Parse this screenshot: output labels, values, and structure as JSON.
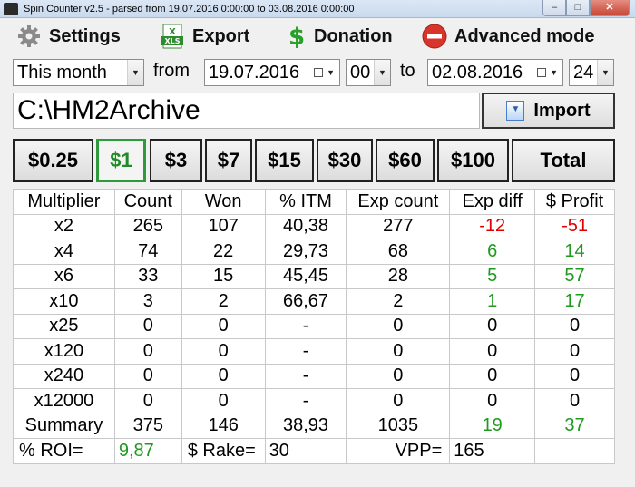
{
  "window": {
    "title": "Spin Counter v2.5 - parsed from 19.07.2016 0:00:00 to 03.08.2016 0:00:00",
    "icon_text": "SPIN"
  },
  "toolbar": {
    "settings": "Settings",
    "export": "Export",
    "donation": "Donation",
    "advanced": "Advanced mode"
  },
  "filters": {
    "period": "This month",
    "from_label": "from",
    "from_date": "19.07.2016",
    "from_hour": "00",
    "to_label": "to",
    "to_date": "02.08.2016",
    "to_hour": "24"
  },
  "path": {
    "value": "C:\\HM2Archive"
  },
  "import_label": "Import",
  "stakes": [
    "$0.25",
    "$1",
    "$3",
    "$7",
    "$15",
    "$30",
    "$60",
    "$100",
    "Total"
  ],
  "active_stake": "$1",
  "table": {
    "headers": [
      "Multiplier",
      "Count",
      "Won",
      "% ITM",
      "Exp count",
      "Exp diff",
      "$ Profit"
    ],
    "rows": [
      [
        "x2",
        "265",
        "107",
        "40,38",
        "277",
        "-12",
        "-51"
      ],
      [
        "x4",
        "74",
        "22",
        "29,73",
        "68",
        "6",
        "14"
      ],
      [
        "x6",
        "33",
        "15",
        "45,45",
        "28",
        "5",
        "57"
      ],
      [
        "x10",
        "3",
        "2",
        "66,67",
        "2",
        "1",
        "17"
      ],
      [
        "x25",
        "0",
        "0",
        "-",
        "0",
        "0",
        "0"
      ],
      [
        "x120",
        "0",
        "0",
        "-",
        "0",
        "0",
        "0"
      ],
      [
        "x240",
        "0",
        "0",
        "-",
        "0",
        "0",
        "0"
      ],
      [
        "x12000",
        "0",
        "0",
        "-",
        "0",
        "0",
        "0"
      ],
      [
        "Summary",
        "375",
        "146",
        "38,93",
        "1035",
        "19",
        "37"
      ]
    ],
    "footer": {
      "roi_label": "% ROI=",
      "roi_value": "9,87",
      "rake_label": "$ Rake=",
      "rake_value": "30",
      "vpp_label": "VPP=",
      "vpp_value": "165"
    }
  },
  "colors": {
    "negative": "#e00000",
    "positive": "#1f9a1f",
    "active_stake": "#2e9a3b"
  }
}
